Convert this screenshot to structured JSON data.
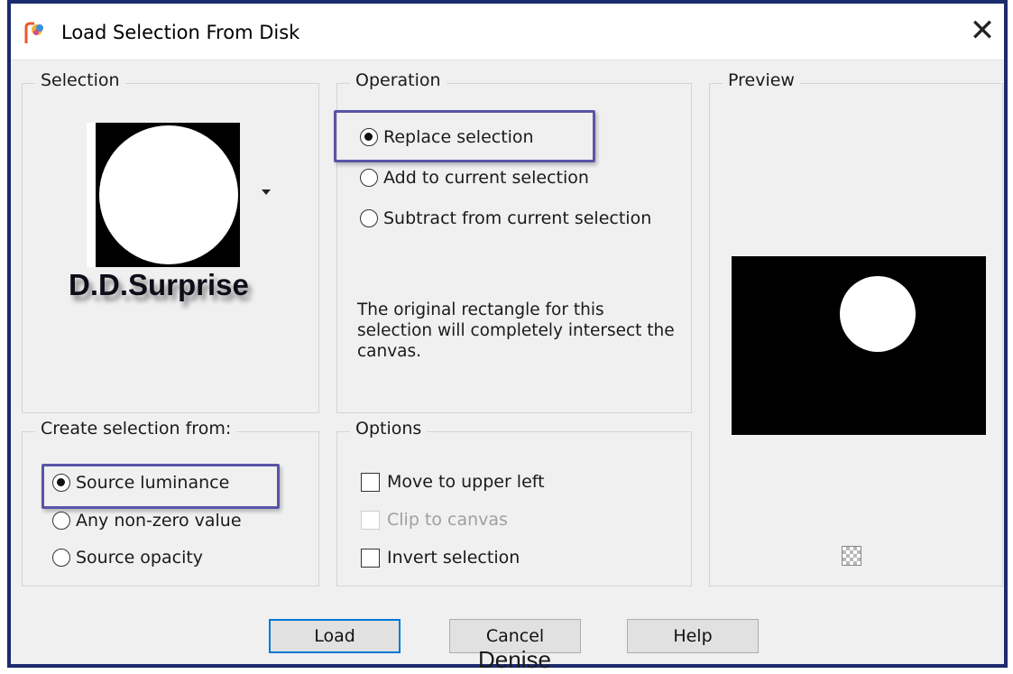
{
  "window": {
    "title": "Load Selection From Disk",
    "close_glyph": "✕",
    "icon": "paintshop-pro-icon"
  },
  "selection_group": {
    "label": "Selection",
    "thumbnail_name": "D.D.Surprise",
    "dropdown_icon": "chevron-down-icon"
  },
  "operation_group": {
    "label": "Operation",
    "options": [
      {
        "label": "Replace selection",
        "checked": true
      },
      {
        "label": "Add to current selection",
        "checked": false
      },
      {
        "label": "Subtract from current selection",
        "checked": false
      }
    ],
    "info": "The original rectangle for this selection will completely intersect the canvas."
  },
  "preview_group": {
    "label": "Preview",
    "transparency_icon": "checkerboard-icon"
  },
  "create_from_group": {
    "label": "Create selection from:",
    "options": [
      {
        "label": "Source luminance",
        "checked": true
      },
      {
        "label": "Any non-zero value",
        "checked": false
      },
      {
        "label": "Source opacity",
        "checked": false
      }
    ]
  },
  "options_group": {
    "label": "Options",
    "checkboxes": [
      {
        "label": "Move to upper left",
        "checked": false,
        "enabled": true
      },
      {
        "label": "Clip to canvas",
        "checked": false,
        "enabled": false
      },
      {
        "label": "Invert selection",
        "checked": false,
        "enabled": true
      }
    ]
  },
  "buttons": {
    "load": "Load",
    "cancel": "Cancel",
    "help": "Help"
  },
  "watermark": "Denise",
  "colors": {
    "highlight": "#5a54a8",
    "default_button_border": "#0078d7",
    "window_border": "#1c2a6e"
  }
}
